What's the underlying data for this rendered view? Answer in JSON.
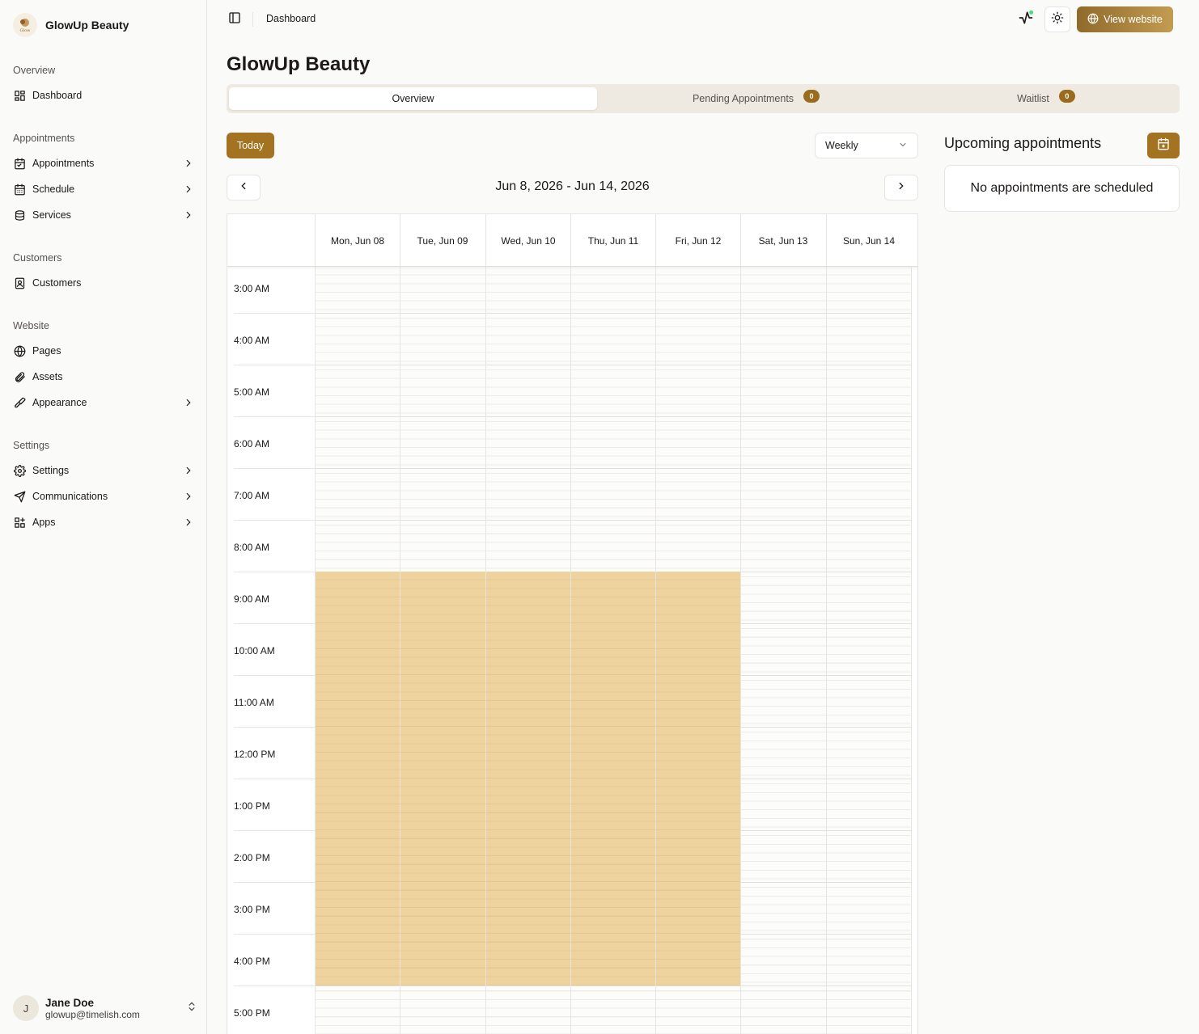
{
  "brand": {
    "name": "GlowUp Beauty",
    "logo_icon": "salon-logo-icon"
  },
  "sidebar": {
    "groups": [
      {
        "title": "Overview",
        "items": [
          {
            "label": "Dashboard",
            "icon": "dashboard-icon",
            "chevron": false
          }
        ]
      },
      {
        "title": "Appointments",
        "items": [
          {
            "label": "Appointments",
            "icon": "calendar-icon",
            "chevron": true
          },
          {
            "label": "Schedule",
            "icon": "calendar-grid-icon",
            "chevron": true
          },
          {
            "label": "Services",
            "icon": "coins-icon",
            "chevron": true
          }
        ]
      },
      {
        "title": "Customers",
        "items": [
          {
            "label": "Customers",
            "icon": "contact-icon",
            "chevron": false
          }
        ]
      },
      {
        "title": "Website",
        "items": [
          {
            "label": "Pages",
            "icon": "globe-icon",
            "chevron": false
          },
          {
            "label": "Assets",
            "icon": "paperclip-icon",
            "chevron": false
          },
          {
            "label": "Appearance",
            "icon": "brush-icon",
            "chevron": true
          }
        ]
      },
      {
        "title": "Settings",
        "items": [
          {
            "label": "Settings",
            "icon": "gear-icon",
            "chevron": true
          },
          {
            "label": "Communications",
            "icon": "send-icon",
            "chevron": true
          },
          {
            "label": "Apps",
            "icon": "apps-icon",
            "chevron": true
          }
        ]
      }
    ]
  },
  "user": {
    "initial": "J",
    "name": "Jane Doe",
    "email": "glowup@timelish.com"
  },
  "header": {
    "breadcrumb": "Dashboard",
    "view_website": "View website"
  },
  "page": {
    "title": "GlowUp Beauty"
  },
  "tabs": [
    {
      "label": "Overview",
      "active": true
    },
    {
      "label": "Pending Appointments",
      "badge": "0"
    },
    {
      "label": "Waitlist",
      "badge": "0"
    }
  ],
  "calendar": {
    "today_label": "Today",
    "view_select": "Weekly",
    "range": "Jun 8, 2026 - Jun 14, 2026",
    "days": [
      "Mon, Jun 08",
      "Tue, Jun 09",
      "Wed, Jun 10",
      "Thu, Jun 11",
      "Fri, Jun 12",
      "Sat, Jun 13",
      "Sun, Jun 14"
    ],
    "hours": [
      "3:00 AM",
      "4:00 AM",
      "5:00 AM",
      "6:00 AM",
      "7:00 AM",
      "8:00 AM",
      "9:00 AM",
      "10:00 AM",
      "11:00 AM",
      "12:00 PM",
      "1:00 PM",
      "2:00 PM",
      "3:00 PM",
      "4:00 PM",
      "5:00 PM"
    ],
    "availability": {
      "days": [
        "Mon, Jun 08",
        "Tue, Jun 09",
        "Wed, Jun 10",
        "Thu, Jun 11",
        "Fri, Jun 12"
      ],
      "start": "9:00 AM",
      "end": "5:00 PM",
      "color": "#eed39f"
    }
  },
  "upcoming": {
    "title": "Upcoming appointments",
    "empty": "No appointments are scheduled"
  },
  "colors": {
    "accent": "#a37321",
    "badge": "#9a6b1c",
    "status_dot": "#4ade80"
  }
}
